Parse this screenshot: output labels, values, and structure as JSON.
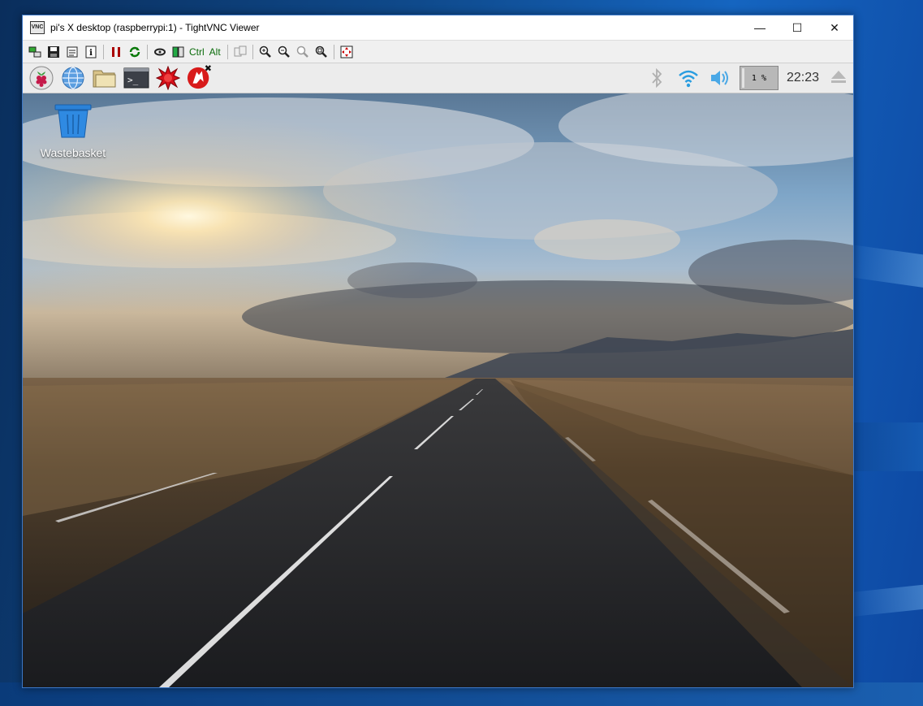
{
  "window": {
    "title": "pi's X desktop (raspberrypi:1) - TightVNC Viewer",
    "app_icon_text": "VNC",
    "controls": {
      "minimize": "—",
      "maximize": "☐",
      "close": "✕"
    }
  },
  "toolbar": {
    "ctrl_label": "Ctrl",
    "alt_label": "Alt"
  },
  "pi_panel": {
    "launchers": [
      "raspberry-menu-icon",
      "web-browser-icon",
      "file-manager-icon",
      "terminal-icon",
      "wolfram-mathematica-icon",
      "wolfram-icon"
    ],
    "cpu_label": "1 %",
    "cpu_value": 1,
    "clock": "22:23"
  },
  "desktop": {
    "icons": [
      {
        "label": "Wastebasket",
        "icon": "wastebasket-icon"
      }
    ]
  },
  "colors": {
    "panel_bg": "#ececec",
    "wifi_blue": "#2a9de0",
    "bluetooth_gray": "#b0b0b0"
  }
}
